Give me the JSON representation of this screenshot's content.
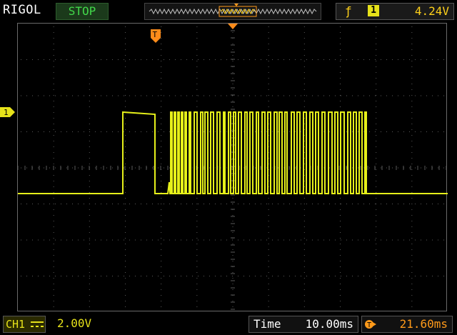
{
  "header": {
    "brand": "RIGOL",
    "run_state": "STOP",
    "trigger_edge_icon": "rising-edge-icon",
    "trigger_source": "1",
    "trigger_level": "4.24V"
  },
  "screen": {
    "channel_marker": "1",
    "trigger_marker_label": "T",
    "colors": {
      "trace": "#e6f01a",
      "grid": "#5a5a5a",
      "trigger_marker": "#ff8c1a"
    }
  },
  "footer": {
    "channel_label": "CH1",
    "coupling_icon": "dc-coupling-icon",
    "volts_per_div": "2.00V",
    "time_label": "Time",
    "time_per_div": "10.00ms",
    "trigger_offset_icon": "trigger-offset-icon",
    "trigger_offset": "21.60ms"
  }
}
